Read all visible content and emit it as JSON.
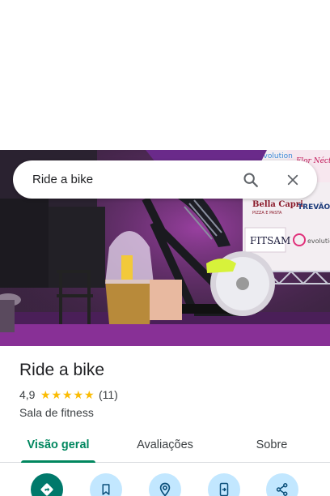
{
  "search": {
    "query": "Ride a bike",
    "search_icon": "search-icon",
    "clear_icon": "close-icon"
  },
  "photo": {
    "signs": [
      "Bella Capri",
      "PIZZA E PASTA",
      "TREVÃO",
      "evolution",
      "FITSAM",
      "evolution",
      "Flor Néctar"
    ]
  },
  "place": {
    "name": "Ride a bike",
    "rating": "4,9",
    "stars": 5,
    "review_count": "(11)",
    "category": "Sala de fitness"
  },
  "tabs": [
    {
      "label": "Visão geral",
      "active": true
    },
    {
      "label": "Avaliações",
      "active": false
    },
    {
      "label": "Sobre",
      "active": false
    }
  ],
  "actions": [
    {
      "icon": "directions-icon"
    },
    {
      "icon": "bookmark-icon"
    },
    {
      "icon": "nearby-icon"
    },
    {
      "icon": "send-to-phone-icon"
    },
    {
      "icon": "share-icon"
    }
  ],
  "colors": {
    "accent": "#01875f",
    "star": "#fbbc04",
    "action_bg": "#c2e7ff",
    "action_primary": "#00796b"
  }
}
